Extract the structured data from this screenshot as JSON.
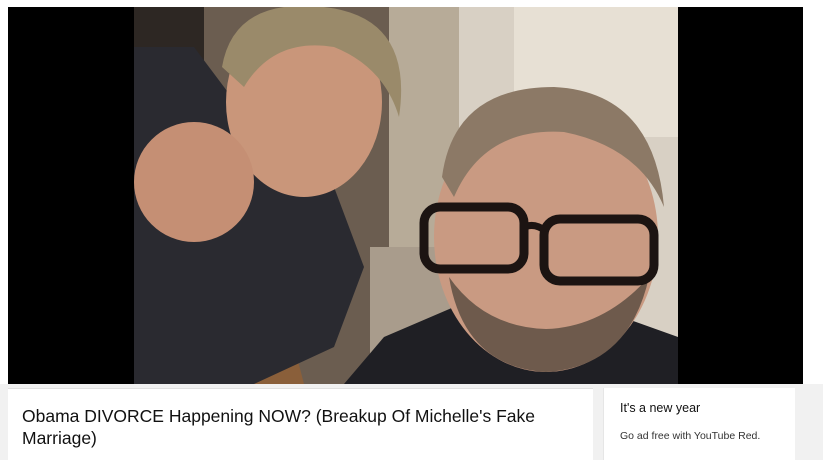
{
  "video": {
    "title": "Obama DIVORCE Happening NOW? (Breakup Of Michelle's Fake Marriage)"
  },
  "promo": {
    "headline": "It's a new year",
    "subtext": "Go ad free with YouTube Red."
  },
  "colors": {
    "player_background": "#000000",
    "page_background": "#f1f1f1",
    "card_background": "#ffffff",
    "text_primary": "#111111"
  }
}
